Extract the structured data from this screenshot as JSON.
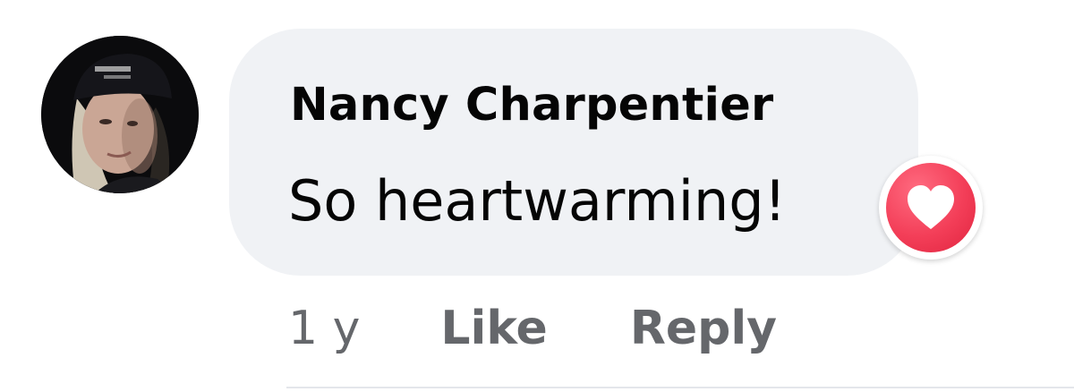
{
  "comment": {
    "author": "Nancy Charpentier",
    "text": "So heartwarming!",
    "reaction": "love-icon",
    "reaction_color": "#f33e58"
  },
  "actions": {
    "timestamp": "1 y",
    "like_label": "Like",
    "reply_label": "Reply"
  },
  "colors": {
    "bubble_background": "#f0f2f5",
    "secondary_text": "#65676b",
    "primary_text": "#050505"
  }
}
